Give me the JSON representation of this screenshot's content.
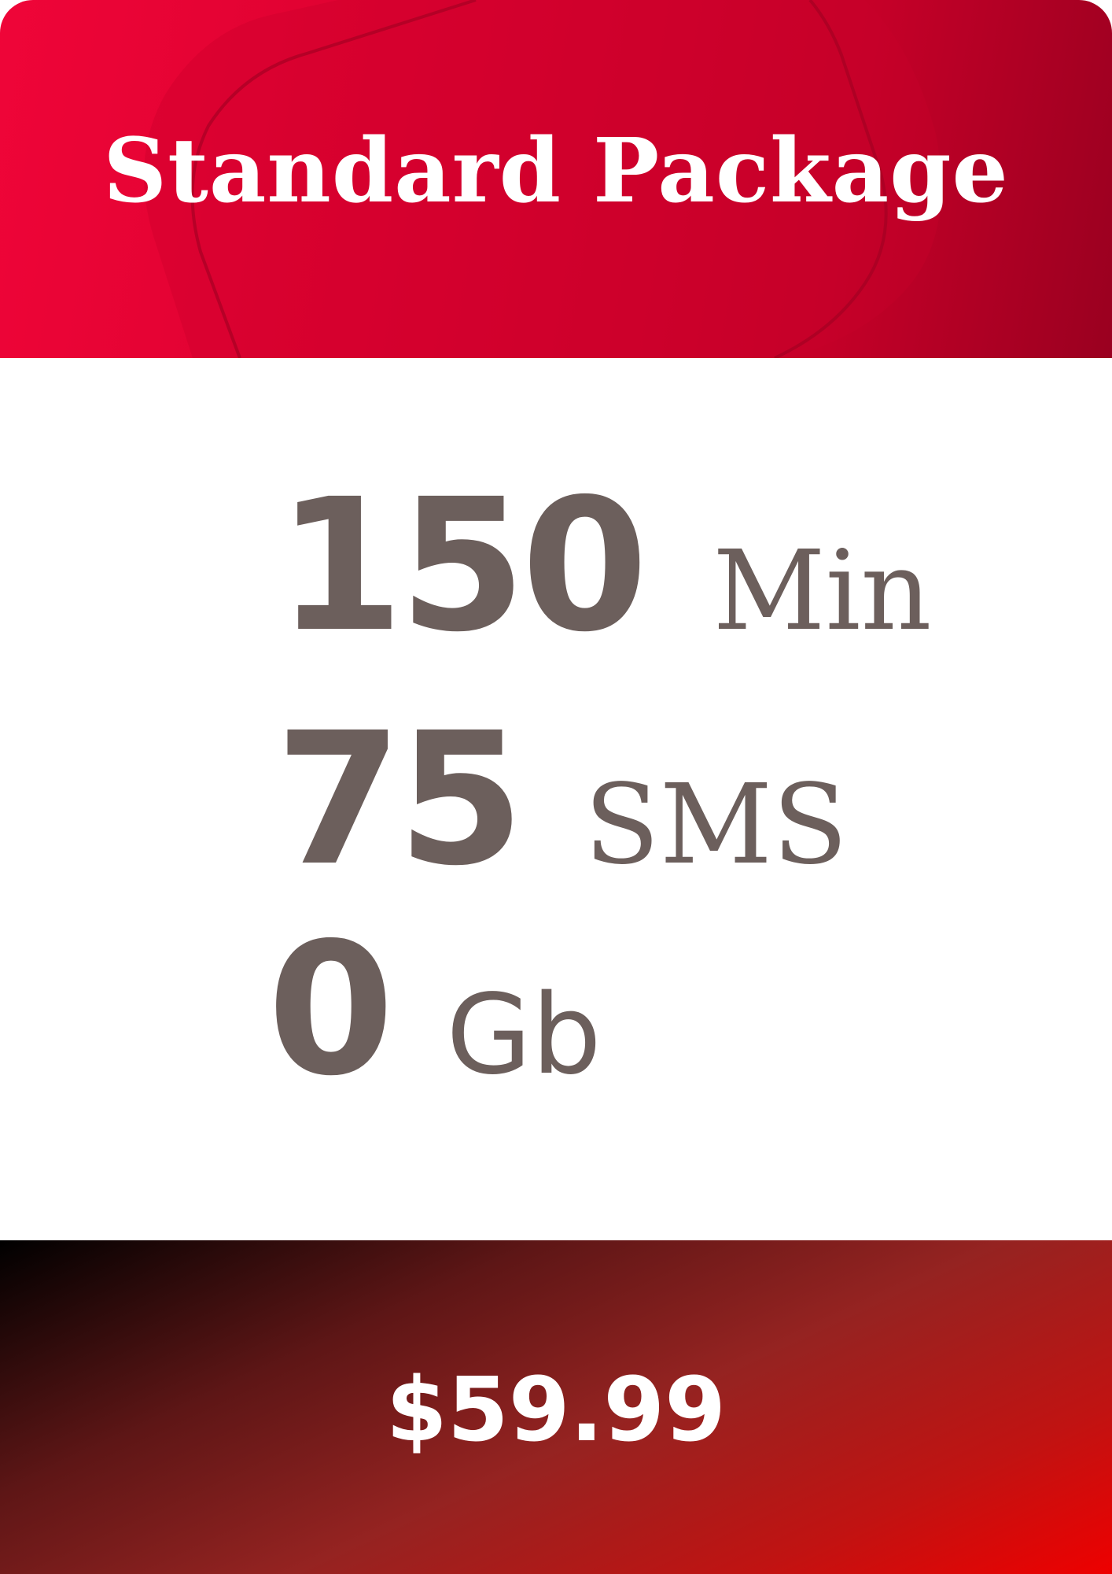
{
  "header": {
    "title": "Standard Package"
  },
  "features": [
    {
      "value": "150",
      "unit": "Min"
    },
    {
      "value": "75",
      "unit": "SMS"
    },
    {
      "value": "0",
      "unit": "Gb"
    }
  ],
  "footer": {
    "price": "$59.99"
  },
  "colors": {
    "header_red": "#e0002f",
    "text_gray_brown": "#6c5f5c",
    "footer_dark": "#000000",
    "footer_red": "#ee0000",
    "white": "#ffffff"
  }
}
